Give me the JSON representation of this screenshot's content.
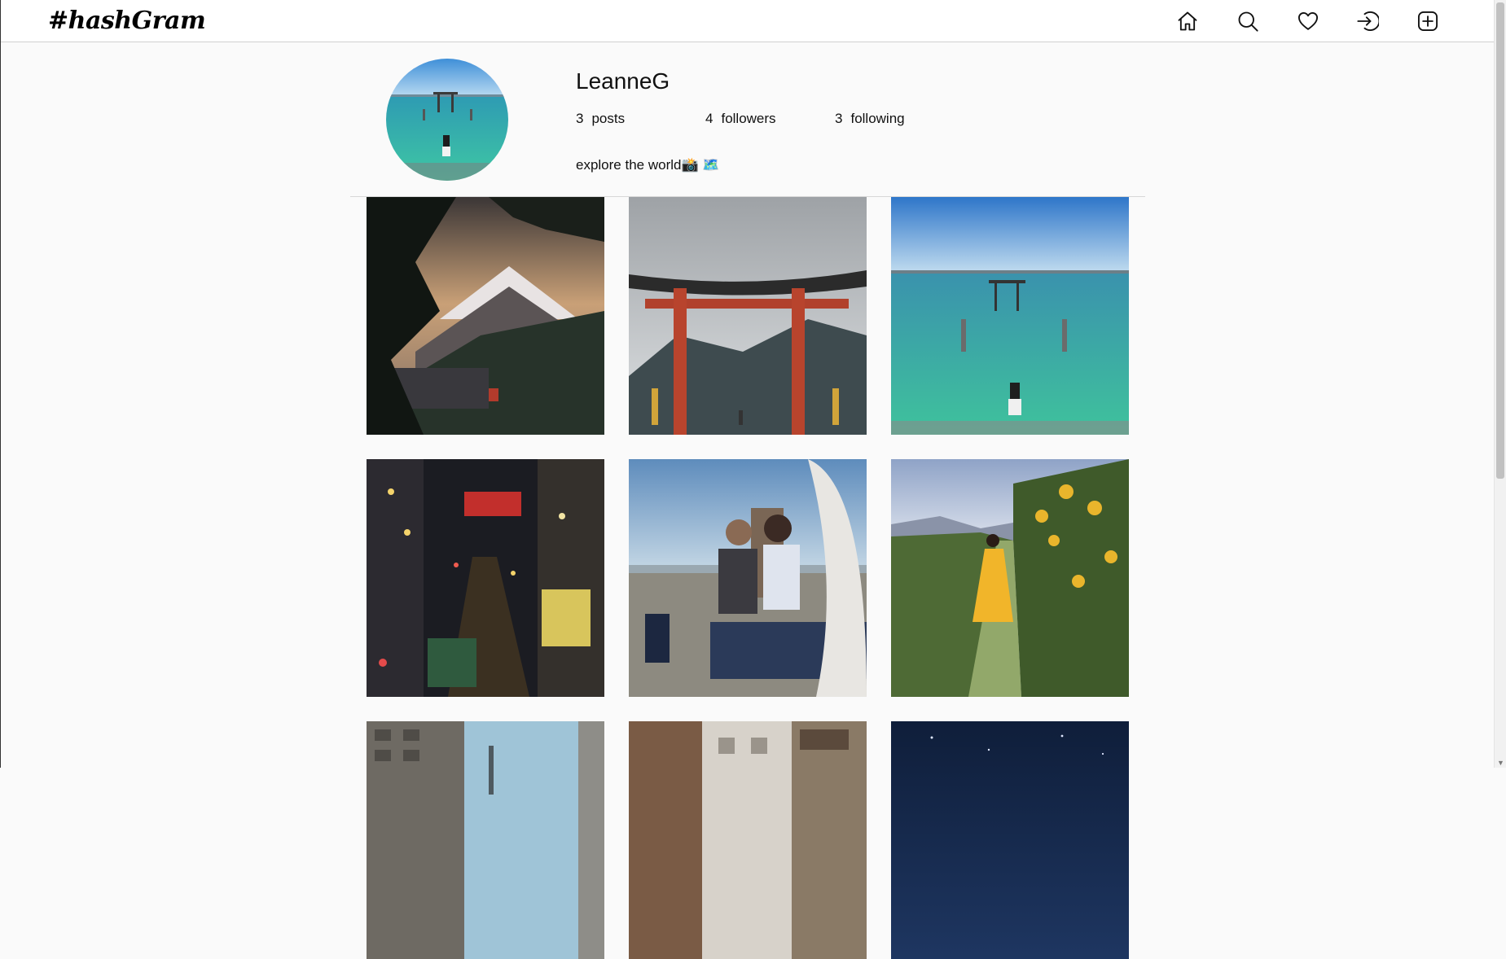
{
  "app": {
    "logo": "#hashGram"
  },
  "nav": {
    "icons": [
      "home-icon",
      "search-icon",
      "heart-icon",
      "login-icon",
      "add-post-icon"
    ]
  },
  "profile": {
    "username": "LeanneG",
    "posts_count": "3",
    "posts_label": "posts",
    "followers_count": "4",
    "followers_label": "followers",
    "following_count": "3",
    "following_label": "following",
    "bio": "explore the world📸 🗺️"
  },
  "grid": {
    "posts": [
      "fuji-lake",
      "torii-mountain",
      "torii-sea",
      "city-night",
      "friends-beach",
      "sunflower-field",
      "building-street",
      "old-street",
      "night-sky"
    ]
  },
  "colors": {
    "accent": "#111111",
    "background": "#fafafa",
    "divider": "#d7d7d7"
  }
}
